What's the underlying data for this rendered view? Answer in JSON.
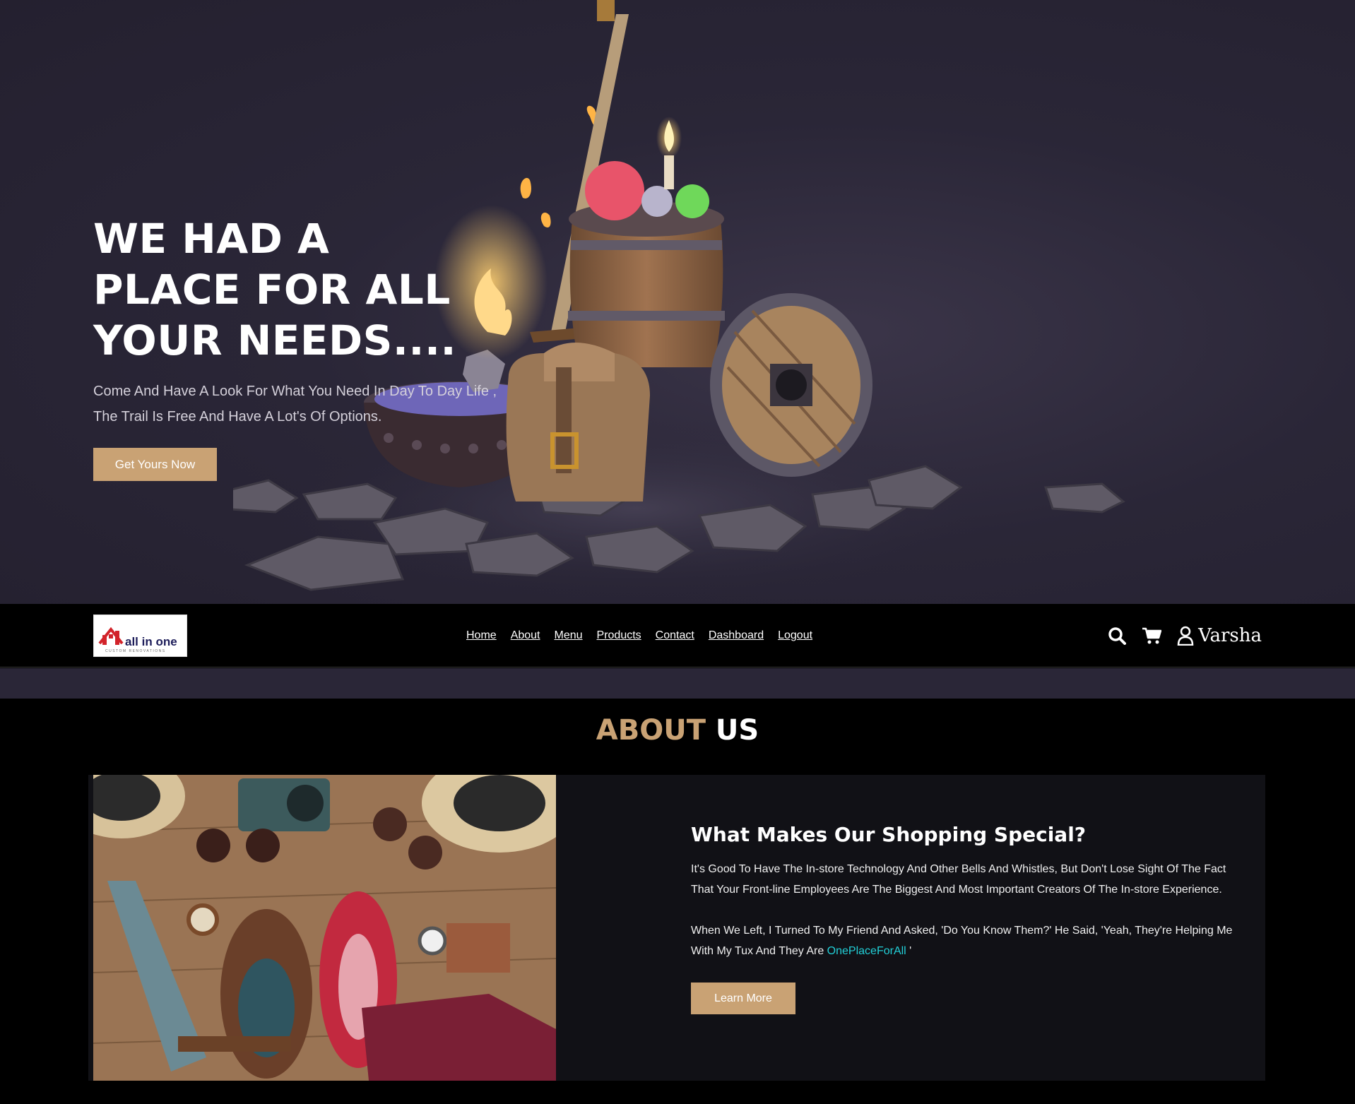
{
  "hero": {
    "title": "WE HAD A PLACE FOR ALL YOUR NEEDS....",
    "subtitle": "Come And Have A Look For What You Need In Day To Day Life , The Trail Is Free And Have A Lot's Of Options.",
    "cta_label": "Get Yours Now"
  },
  "nav": {
    "logo_text": "all in one",
    "logo_subtext": "CUSTOM RENOVATIONS",
    "links": [
      "Home",
      "About",
      "Menu",
      "Products",
      "Contact",
      "Dashboard",
      "Logout"
    ],
    "user_name": "Varsha"
  },
  "about": {
    "heading_accent": "ABOUT",
    "heading_rest": "US",
    "title": "What Makes Our Shopping Special?",
    "paragraph1": "It's Good To Have The In-store Technology And Other Bells And Whistles, But Don't Lose Sight Of The Fact That Your Front-line Employees Are The Biggest And Most Important Creators Of The In-store Experience.",
    "paragraph2_before": "When We Left, I Turned To My Friend And Asked, 'Do You Know Them?' He Said, 'Yeah, They're Helping Me With My Tux And They Are ",
    "paragraph2_link": "OnePlaceForAll",
    "paragraph2_after": " '",
    "button_label": "Learn More"
  },
  "colors": {
    "accent": "#c9a274",
    "highlight": "#22d0d8",
    "hero_bg": "#2a2637"
  },
  "icons": [
    "search-icon",
    "cart-icon",
    "user-icon"
  ]
}
